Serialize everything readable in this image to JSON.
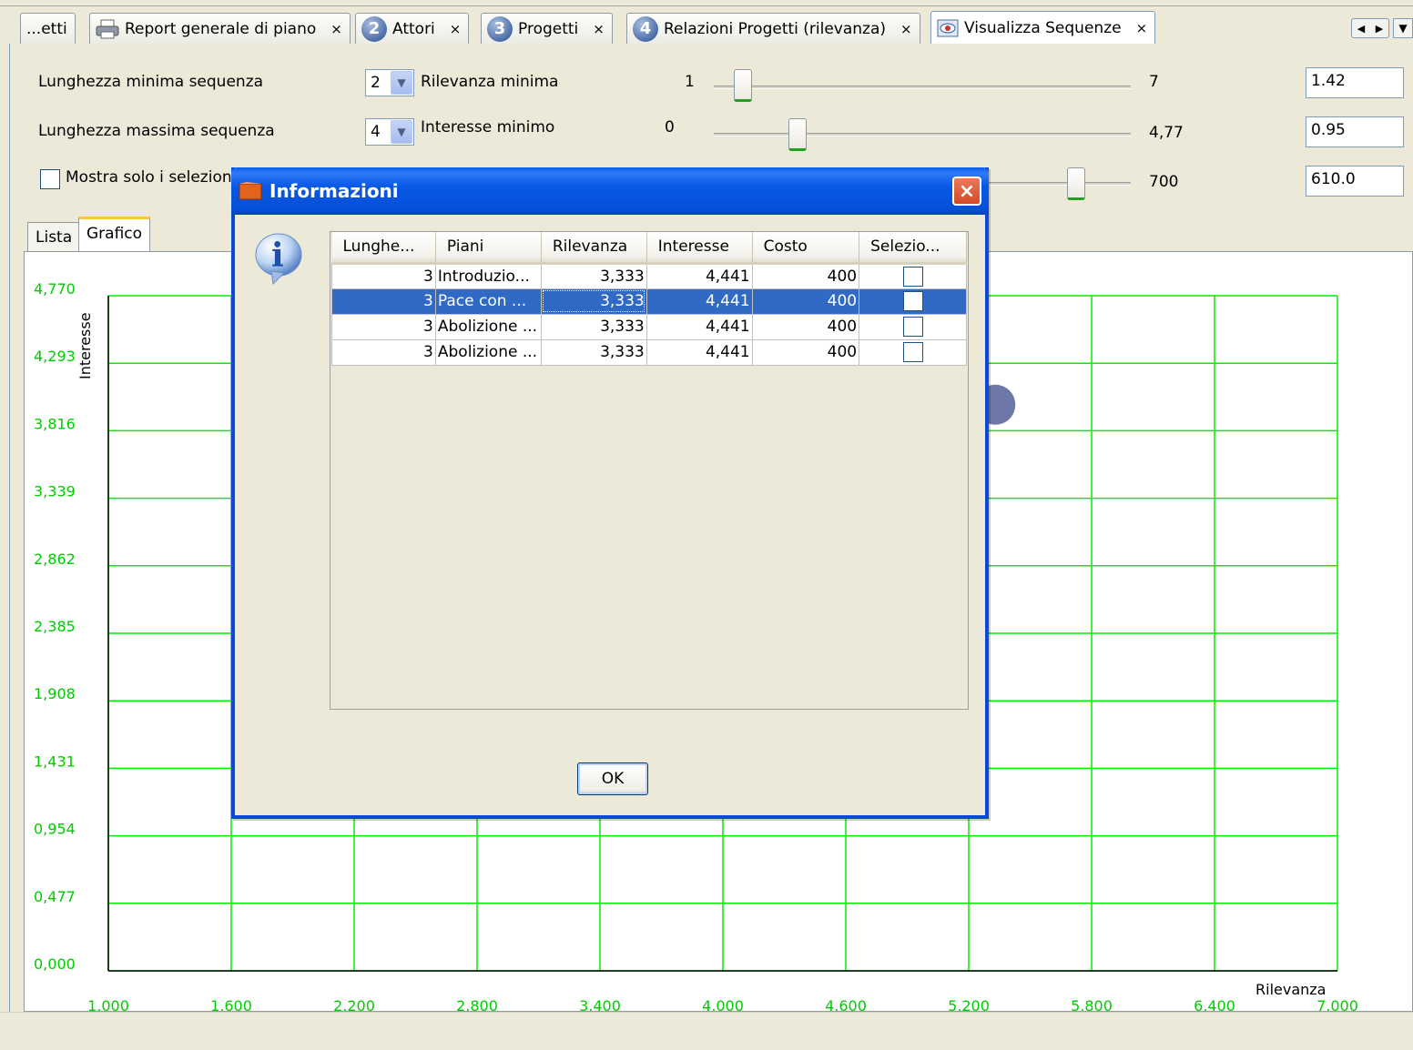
{
  "tabs": [
    {
      "label": "...etti",
      "close": "",
      "icon": ""
    },
    {
      "label": "Report generale di piano",
      "close": "×",
      "icon": "printer-icon"
    },
    {
      "label": "Attori",
      "close": "×",
      "icon": "2"
    },
    {
      "label": "Progetti",
      "close": "×",
      "icon": "3"
    },
    {
      "label": "Relazioni Progetti (rilevanza)",
      "close": "×",
      "icon": "4"
    },
    {
      "label": "Visualizza Sequenze",
      "close": "×",
      "icon": "view-icon"
    }
  ],
  "tab_nav": {
    "left": "◀",
    "right": "▶",
    "dropdown": "▼"
  },
  "controls": {
    "min_length_label": "Lunghezza minima sequenza",
    "min_length_value": "2",
    "max_length_label": "Lunghezza massima sequenza",
    "max_length_value": "4",
    "show_selected_label": "Mostra solo i seleziona",
    "rilevanza_label": "Rilevanza minima",
    "rilevanza_min": "1",
    "rilevanza_max": "7",
    "rilevanza_value": "1.42",
    "rilevanza_fraction": 0.07,
    "interesse_label": "Interesse minimo",
    "interesse_min": "0",
    "interesse_max": "4,77",
    "interesse_value": "0.95",
    "interesse_fraction": 0.2,
    "costo_max": "700",
    "costo_value": "610.0",
    "costo_fraction": 0.87
  },
  "inner_tabs": {
    "list": "Lista",
    "chart": "Grafico"
  },
  "chart_data": {
    "type": "scatter",
    "xlabel": "Rilevanza",
    "ylabel": "Interesse",
    "xlim": [
      1.0,
      7.0
    ],
    "ylim": [
      0.0,
      4.77
    ],
    "x_ticks": [
      "1,000",
      "1,600",
      "2,200",
      "2,800",
      "3,400",
      "4,000",
      "4,600",
      "5,200",
      "5,800",
      "6,400",
      "7,000"
    ],
    "y_ticks": [
      "0,000",
      "0,477",
      "0,954",
      "1,431",
      "1,908",
      "2,385",
      "2,862",
      "3,339",
      "3,816",
      "4,293",
      "4,770"
    ],
    "grid": true,
    "grid_color": "#00ee00",
    "tick_color": "#00cc00",
    "points": [
      {
        "x": 5.33,
        "y": 4.0,
        "color": "#6d78a8"
      }
    ]
  },
  "dialog": {
    "title": "Informazioni",
    "close": "×",
    "info_glyph": "i",
    "ok": "OK",
    "columns": [
      "Lunghe...",
      "Piani",
      "Rilevanza",
      "Interesse",
      "Costo",
      "Selezio..."
    ],
    "rows": [
      {
        "len": "3",
        "piani": "Introduzio...",
        "rilevanza": "3,333",
        "interesse": "4,441",
        "costo": "400",
        "selected": false
      },
      {
        "len": "3",
        "piani": "Pace con ...",
        "rilevanza": "3,333",
        "interesse": "4,441",
        "costo": "400",
        "selected": true
      },
      {
        "len": "3",
        "piani": "Abolizione ...",
        "rilevanza": "3,333",
        "interesse": "4,441",
        "costo": "400",
        "selected": false
      },
      {
        "len": "3",
        "piani": "Abolizione ...",
        "rilevanza": "3,333",
        "interesse": "4,441",
        "costo": "400",
        "selected": false
      }
    ]
  },
  "colors": {
    "accent": "#0a49d7",
    "selection": "#316ac5",
    "grid": "#00ee00"
  }
}
